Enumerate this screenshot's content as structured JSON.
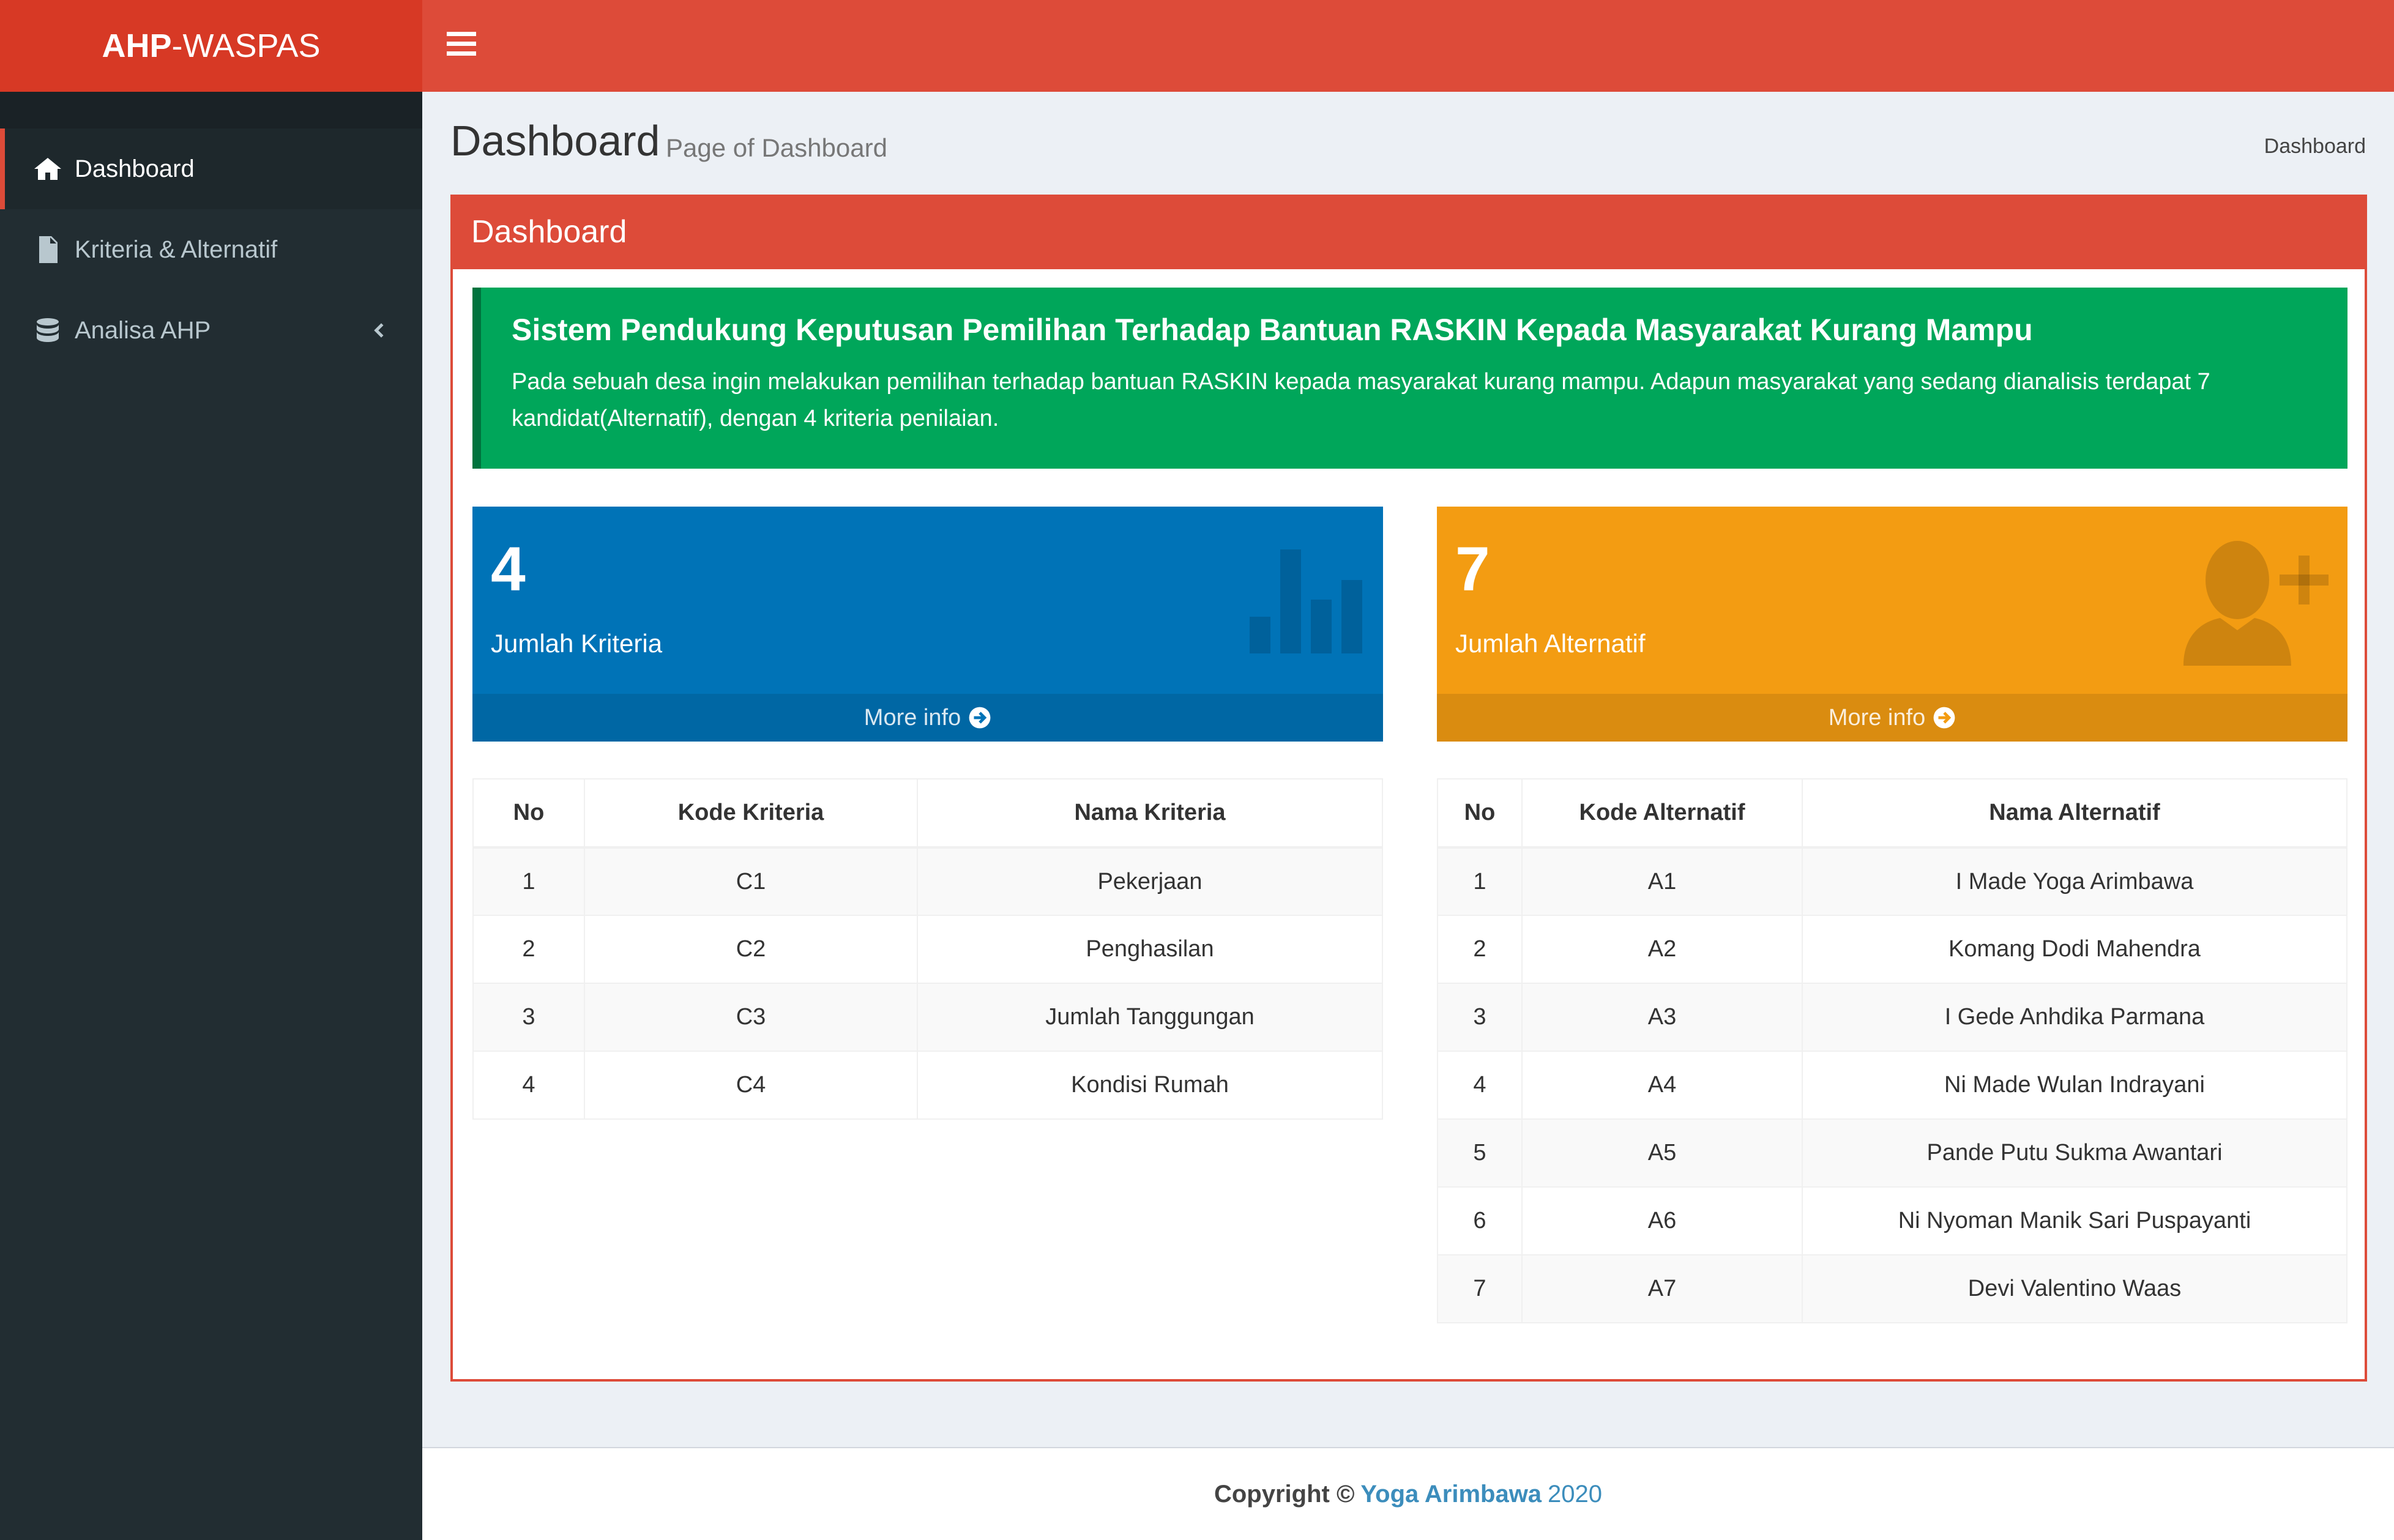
{
  "app": {
    "logo_bold": "AHP",
    "logo_rest": "-WASPAS"
  },
  "sidebar": {
    "items": [
      {
        "label": "Dashboard",
        "icon": "home-icon"
      },
      {
        "label": "Kriteria & Alternatif",
        "icon": "file-icon"
      },
      {
        "label": "Analisa AHP",
        "icon": "database-icon"
      }
    ]
  },
  "page": {
    "title": "Dashboard",
    "subtitle": "Page of Dashboard",
    "breadcrumb": "Dashboard"
  },
  "box": {
    "title": "Dashboard"
  },
  "callout": {
    "title": "Sistem Pendukung Keputusan Pemilihan Terhadap Bantuan RASKIN Kepada Masyarakat Kurang Mampu",
    "text": "Pada sebuah desa ingin melakukan pemilihan terhadap bantuan RASKIN kepada masyarakat kurang mampu. Adapun masyarakat yang sedang dianalisis terdapat 7 kandidat(Alternatif), dengan 4 kriteria penilaian."
  },
  "stats": [
    {
      "value": "4",
      "label": "Jumlah Kriteria",
      "more": "More info",
      "color": "#0073b7",
      "icon": "bar-chart-icon"
    },
    {
      "value": "7",
      "label": "Jumlah Alternatif",
      "more": "More info",
      "color": "#f39c12",
      "icon": "user-plus-icon"
    }
  ],
  "kriteria_table": {
    "headers": [
      "No",
      "Kode Kriteria",
      "Nama Kriteria"
    ],
    "rows": [
      [
        "1",
        "C1",
        "Pekerjaan"
      ],
      [
        "2",
        "C2",
        "Penghasilan"
      ],
      [
        "3",
        "C3",
        "Jumlah Tanggungan"
      ],
      [
        "4",
        "C4",
        "Kondisi Rumah"
      ]
    ]
  },
  "alternatif_table": {
    "headers": [
      "No",
      "Kode Alternatif",
      "Nama Alternatif"
    ],
    "rows": [
      [
        "1",
        "A1",
        "I Made Yoga Arimbawa"
      ],
      [
        "2",
        "A2",
        "Komang Dodi Mahendra"
      ],
      [
        "3",
        "A3",
        "I Gede Anhdika Parmana"
      ],
      [
        "4",
        "A4",
        "Ni Made Wulan Indrayani"
      ],
      [
        "5",
        "A5",
        "Pande Putu Sukma Awantari"
      ],
      [
        "6",
        "A6",
        "Ni Nyoman Manik Sari Puspayanti"
      ],
      [
        "7",
        "A7",
        "Devi Valentino Waas"
      ]
    ]
  },
  "footer": {
    "copyright": "Copyright ©",
    "author": "Yoga Arimbawa",
    "year": "2020"
  },
  "colors": {
    "header": "#dd4b39",
    "sidebar": "#222d32",
    "success": "#00a65a"
  }
}
